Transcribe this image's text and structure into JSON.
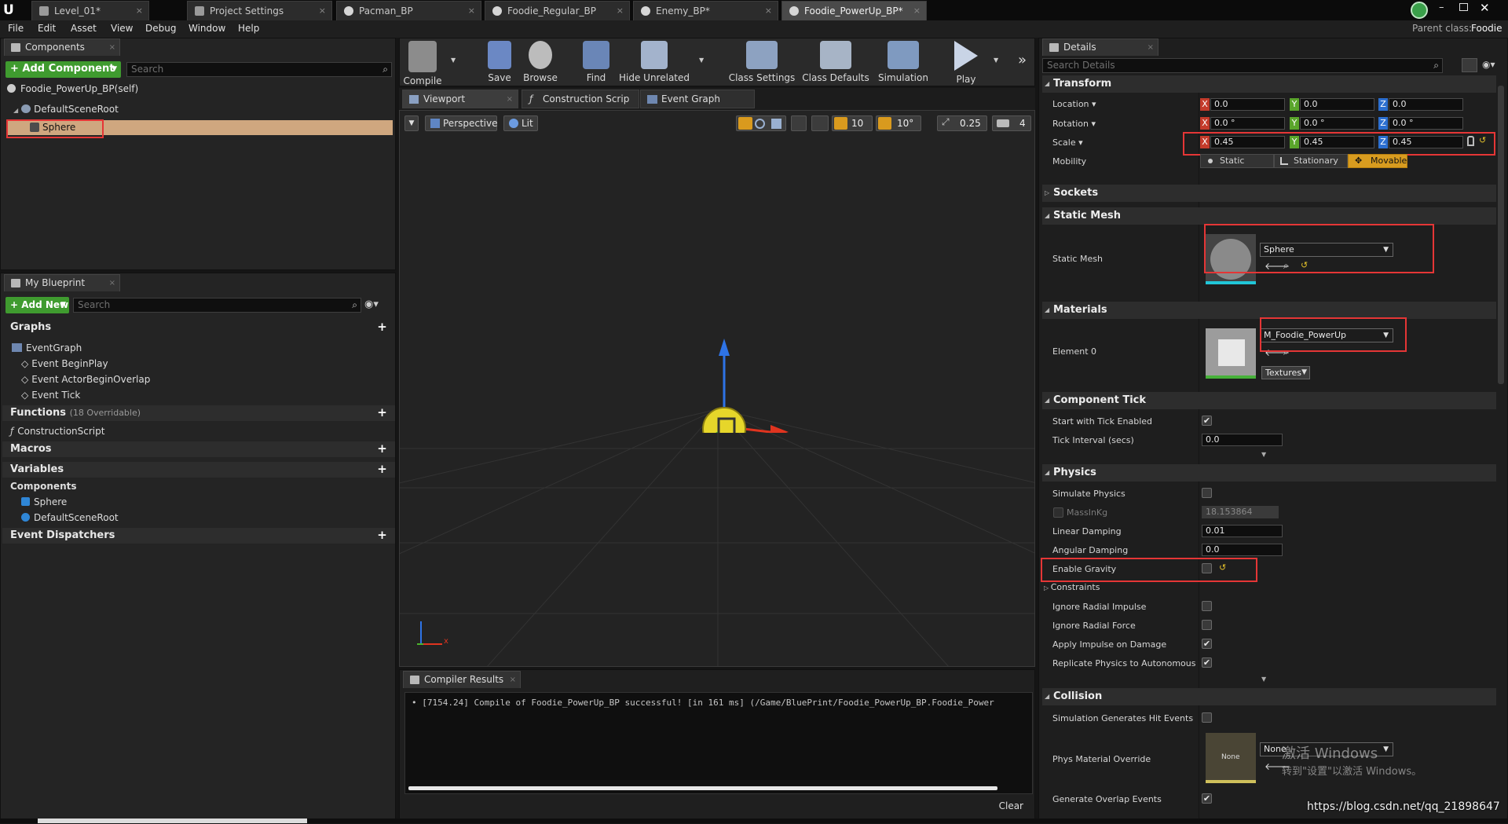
{
  "titlebar": {
    "tabs": [
      {
        "label": "Level_01*"
      },
      {
        "label": "Project Settings"
      },
      {
        "label": "Pacman_BP"
      },
      {
        "label": "Foodie_Regular_BP"
      },
      {
        "label": "Enemy_BP*"
      },
      {
        "label": "Foodie_PowerUp_BP*"
      }
    ],
    "parent_class_label": "Parent class:",
    "parent_class_value": "Foodie"
  },
  "menu": [
    "File",
    "Edit",
    "Asset",
    "View",
    "Debug",
    "Window",
    "Help"
  ],
  "components_panel": {
    "title": "Components",
    "add_button": "+ Add Component",
    "search_placeholder": "Search",
    "self_label": "Foodie_PowerUp_BP(self)",
    "root_label": "DefaultSceneRoot",
    "child_label": "Sphere"
  },
  "my_blueprint": {
    "title": "My Blueprint",
    "add_new": "+ Add New",
    "search_placeholder": "Search",
    "graphs_label": "Graphs",
    "event_graph": "EventGraph",
    "events": [
      "Event BeginPlay",
      "Event ActorBeginOverlap",
      "Event Tick"
    ],
    "functions_label": "Functions",
    "functions_count": "(18 Overridable)",
    "construction_script": "ConstructionScript",
    "macros_label": "Macros",
    "variables_label": "Variables",
    "components_label": "Components",
    "component_items": [
      "Sphere",
      "DefaultSceneRoot"
    ],
    "dispatchers_label": "Event Dispatchers"
  },
  "toolbar": {
    "items": [
      "Compile",
      "Save",
      "Browse",
      "Find",
      "Hide Unrelated",
      "Class Settings",
      "Class Defaults",
      "Simulation",
      "Play"
    ]
  },
  "editor_tabs": {
    "viewport": "Viewport",
    "construction": "Construction Scrip",
    "event_graph": "Event Graph"
  },
  "viewport": {
    "perspective": "Perspective",
    "lit": "Lit",
    "grid_snap": "10",
    "rot_snap": "10°",
    "scale_snap": "0.25",
    "cam_speed": "4"
  },
  "compiler": {
    "title": "Compiler Results",
    "message": "• [7154.24] Compile of Foodie_PowerUp_BP successful! [in 161 ms] (/Game/BluePrint/Foodie_PowerUp_BP.Foodie_Power",
    "clear": "Clear"
  },
  "details": {
    "title": "Details",
    "search_placeholder": "Search Details",
    "transform": {
      "header": "Transform",
      "location_label": "Location",
      "location": [
        "0.0",
        "0.0",
        "0.0"
      ],
      "rotation_label": "Rotation",
      "rotation": [
        "0.0 °",
        "0.0 °",
        "0.0 °"
      ],
      "scale_label": "Scale",
      "scale": [
        "0.45",
        "0.45",
        "0.45"
      ],
      "mobility_label": "Mobility",
      "mobility_options": [
        "Static",
        "Stationary",
        "Movable"
      ]
    },
    "sockets_header": "Sockets",
    "static_mesh": {
      "header": "Static Mesh",
      "label": "Static Mesh",
      "value": "Sphere"
    },
    "materials": {
      "header": "Materials",
      "label": "Element 0",
      "value": "M_Foodie_PowerUp",
      "textures": "Textures"
    },
    "component_tick": {
      "header": "Component Tick",
      "start_label": "Start with Tick Enabled",
      "start_checked": "✔",
      "interval_label": "Tick Interval (secs)",
      "interval_value": "0.0"
    },
    "physics": {
      "header": "Physics",
      "simulate_label": "Simulate Physics",
      "mass_label": "MassInKg",
      "mass_value": "18.153864",
      "linear_label": "Linear Damping",
      "linear_value": "0.01",
      "angular_label": "Angular Damping",
      "angular_value": "0.0",
      "gravity_label": "Enable Gravity",
      "constraints_label": "Constraints",
      "radial_impulse_label": "Ignore Radial Impulse",
      "radial_force_label": "Ignore Radial Force",
      "apply_impulse_label": "Apply Impulse on Damage",
      "apply_impulse_checked": "✔",
      "replicate_label": "Replicate Physics to Autonomous Pro",
      "replicate_checked": "✔"
    },
    "collision": {
      "header": "Collision",
      "hit_events_label": "Simulation Generates Hit Events",
      "phys_material_label": "Phys Material Override",
      "phys_material_value": "None",
      "thumb_text": "None",
      "overlap_label": "Generate Overlap Events",
      "overlap_checked": "✔"
    }
  },
  "watermarks": {
    "activate": "激活 Windows",
    "activate_sub": "转到\"设置\"以激活 Windows。",
    "url": "https://blog.csdn.net/qq_21898647"
  },
  "colors": {
    "green": "#3f9b2f",
    "highlight": "#e53636",
    "selected_row": "#cfa77f",
    "movable": "#d89c1f"
  }
}
